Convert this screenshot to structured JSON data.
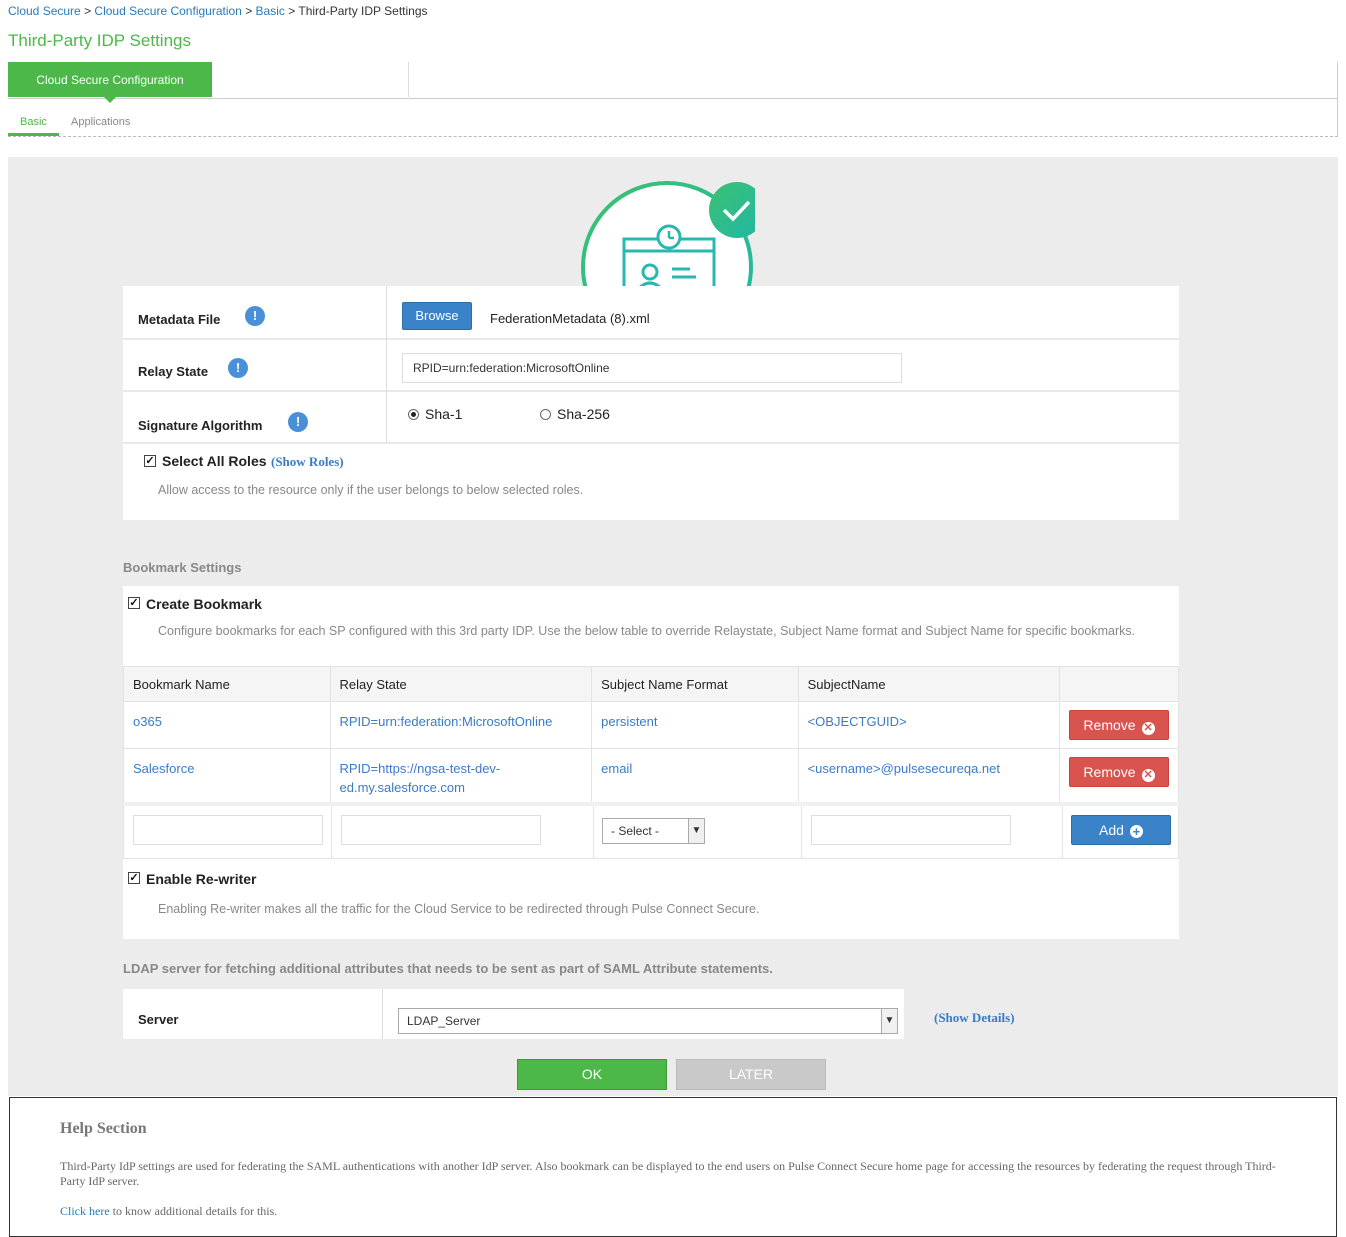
{
  "breadcrumb": {
    "items": [
      "Cloud Secure",
      "Cloud Secure Configuration",
      "Basic"
    ],
    "separator": ">",
    "current": "Third-Party IDP Settings"
  },
  "page_title": "Third-Party IDP Settings",
  "top_tabs": {
    "active": "Cloud Secure Configuration"
  },
  "sub_tabs": [
    "Basic",
    "Applications"
  ],
  "form": {
    "metadata": {
      "label": "Metadata File",
      "browse": "Browse",
      "file": "FederationMetadata (8).xml"
    },
    "relay": {
      "label": "Relay State",
      "value": "RPID=urn:federation:MicrosoftOnline"
    },
    "signature": {
      "label": "Signature Algorithm",
      "option1": "Sha-1",
      "option2": "Sha-256",
      "selected": "Sha-1"
    },
    "info_glyph": "!",
    "roles": {
      "label": "Select All Roles",
      "link": "(Show Roles)",
      "desc": "Allow access to the resource only if the user belongs to below selected roles.",
      "checked": true
    }
  },
  "bookmark": {
    "section_title": "Bookmark Settings",
    "create_label": "Create Bookmark",
    "create_desc": "Configure bookmarks for each SP configured with this 3rd party IDP. Use the below table to override Relaystate, Subject Name format and Subject Name for specific bookmarks.",
    "columns": [
      "Bookmark Name",
      "Relay State",
      "Subject Name Format",
      "SubjectName"
    ],
    "rows": [
      {
        "name": "o365",
        "relay": "RPID=urn:federation:MicrosoftOnline",
        "format": "persistent",
        "subject": "<OBJECTGUID>"
      },
      {
        "name": "Salesforce",
        "relay": "RPID=https://ngsa-test-dev-ed.my.salesforce.com",
        "format": "email",
        "subject": "<username>@pulsesecureqa.net"
      }
    ],
    "remove_label": "Remove",
    "add_label": "Add",
    "select_placeholder": "- Select -"
  },
  "rewriter": {
    "label": "Enable Re-writer",
    "desc": "Enabling Re-writer makes all the traffic for the Cloud Service to be redirected through Pulse Connect Secure.",
    "checked": true
  },
  "ldap": {
    "title": "LDAP server for fetching additional attributes that needs to be sent as part of SAML Attribute statements.",
    "server_label": "Server",
    "server_value": "LDAP_Server",
    "show_details": "(Show Details)"
  },
  "buttons": {
    "ok": "OK",
    "later": "LATER"
  },
  "help": {
    "title": "Help Section",
    "text": "Third-Party IdP settings are used for federating the SAML authentications with another IdP server. Also bookmark can be displayed to the end users on Pulse Connect Secure home page for accessing the resources by federating the request through Third-Party IdP server.",
    "link": "Click here",
    "link_suffix": "to know additional details for this."
  },
  "colors": {
    "green": "#4cb848",
    "blue": "#3a83c8",
    "red": "#d9534f",
    "panel": "#ececed"
  }
}
